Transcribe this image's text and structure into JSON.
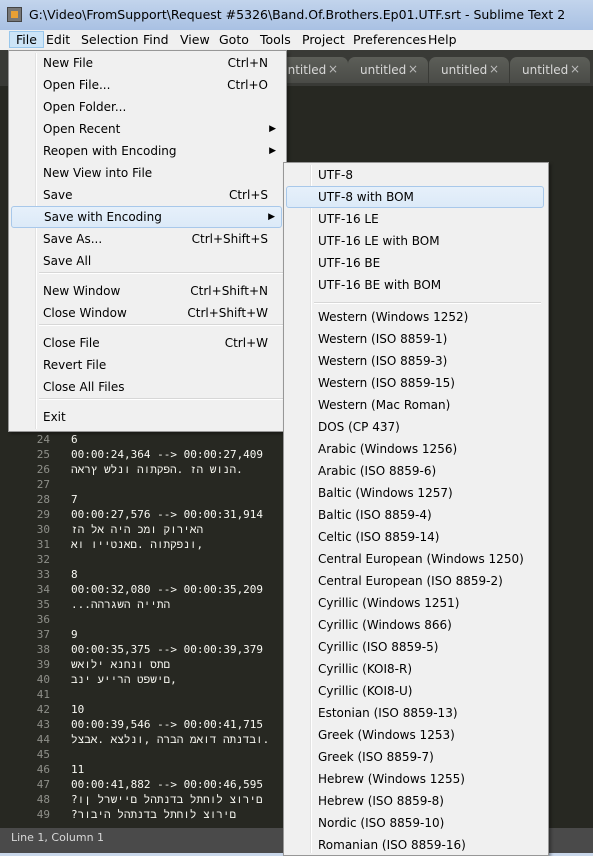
{
  "window": {
    "title": "G:\\Video\\FromSupport\\Request #5326\\Band.Of.Brothers.Ep01.UTF.srt - Sublime Text 2"
  },
  "menubar": [
    "File",
    "Edit",
    "Selection",
    "Find",
    "View",
    "Goto",
    "Tools",
    "Project",
    "Preferences",
    "Help"
  ],
  "tabs": [
    {
      "label": "untitled",
      "close": "×"
    },
    {
      "label": "untitled",
      "close": "×"
    },
    {
      "label": "untitled",
      "close": "×"
    },
    {
      "label": "untitled",
      "close": "×"
    }
  ],
  "file_menu": [
    {
      "label": "New File",
      "shortcut": "Ctrl+N"
    },
    {
      "label": "Open File...",
      "shortcut": "Ctrl+O"
    },
    {
      "label": "Open Folder...",
      "shortcut": ""
    },
    {
      "label": "Open Recent",
      "shortcut": "",
      "submenu": true
    },
    {
      "label": "Reopen with Encoding",
      "shortcut": "",
      "submenu": true
    },
    {
      "label": "New View into File",
      "shortcut": ""
    },
    {
      "label": "Save",
      "shortcut": "Ctrl+S"
    },
    {
      "label": "Save with Encoding",
      "shortcut": "",
      "submenu": true,
      "highlighted": true
    },
    {
      "label": "Save As...",
      "shortcut": "Ctrl+Shift+S"
    },
    {
      "label": "Save All",
      "shortcut": ""
    },
    {
      "label": "New Window",
      "shortcut": "Ctrl+Shift+N"
    },
    {
      "label": "Close Window",
      "shortcut": "Ctrl+Shift+W"
    },
    {
      "label": "Close File",
      "shortcut": "Ctrl+W"
    },
    {
      "label": "Revert File",
      "shortcut": ""
    },
    {
      "label": "Close All Files",
      "shortcut": ""
    },
    {
      "label": "Exit",
      "shortcut": ""
    }
  ],
  "encoding_menu": [
    "UTF-8",
    "UTF-8 with BOM",
    "UTF-16 LE",
    "UTF-16 LE with BOM",
    "UTF-16 BE",
    "UTF-16 BE with BOM",
    "Western (Windows 1252)",
    "Western (ISO 8859-1)",
    "Western (ISO 8859-3)",
    "Western (ISO 8859-15)",
    "Western (Mac Roman)",
    "DOS (CP 437)",
    "Arabic (Windows 1256)",
    "Arabic (ISO 8859-6)",
    "Baltic (Windows 1257)",
    "Baltic (ISO 8859-4)",
    "Celtic (ISO 8859-14)",
    "Central European (Windows 1250)",
    "Central European (ISO 8859-2)",
    "Cyrillic (Windows 1251)",
    "Cyrillic (Windows 866)",
    "Cyrillic (ISO 8859-5)",
    "Cyrillic (KOI8-R)",
    "Cyrillic (KOI8-U)",
    "Estonian (ISO 8859-13)",
    "Greek (Windows 1253)",
    "Greek (ISO 8859-7)",
    "Hebrew (Windows 1255)",
    "Hebrew (ISO 8859-8)",
    "Nordic (ISO 8859-10)",
    "Romanian (ISO 8859-16)"
  ],
  "encoding_highlighted": "UTF-8 with BOM",
  "code_lines": [
    {
      "n": "24",
      "t": "6"
    },
    {
      "n": "25",
      "t": "00:00:24,364 --> 00:00:27,409"
    },
    {
      "n": "26",
      "t": "הנוש הז .הפקתוה ונלש ץראה."
    },
    {
      "n": "27",
      "t": ""
    },
    {
      "n": "28",
      "t": "7"
    },
    {
      "n": "29",
      "t": "00:00:27,576 --> 00:00:31,914"
    },
    {
      "n": "30",
      "t": "האירוק ומכ היה אל הז"
    },
    {
      "n": "31",
      "t": "ונפקתוה .םאנטייו וא,"
    },
    {
      "n": "32",
      "t": ""
    },
    {
      "n": "33",
      "t": "8"
    },
    {
      "n": "34",
      "t": "00:00:32,080 --> 00:00:35,209"
    },
    {
      "n": "35",
      "t": "...התייה השגרהה"
    },
    {
      "n": "36",
      "t": ""
    },
    {
      "n": "37",
      "t": "9"
    },
    {
      "n": "38",
      "t": "00:00:35,375 --> 00:00:39,379"
    },
    {
      "n": "39",
      "t": "םתס ונחנא ילואש"
    },
    {
      "n": "40",
      "t": "םישפט הרייע ינב,"
    },
    {
      "n": "41",
      "t": ""
    },
    {
      "n": "42",
      "t": "10"
    },
    {
      "n": "43",
      "t": "00:00:39,546 --> 00:00:41,715"
    },
    {
      "n": "44",
      "t": "ובדנתה דואמ הברה ,ונלצא .אבצל."
    },
    {
      "n": "45",
      "t": ""
    },
    {
      "n": "46",
      "t": "11"
    },
    {
      "n": "47",
      "t": "00:00:41,882 --> 00:00:46,595"
    },
    {
      "n": "48",
      "t": "?םירוצ לוחתל בדנתהל םיישרל ןו"
    },
    {
      "n": "49",
      "t": "?םירוצ לוחתל בדנתהל היבור"
    }
  ],
  "status": {
    "text": "Line 1, Column 1"
  }
}
